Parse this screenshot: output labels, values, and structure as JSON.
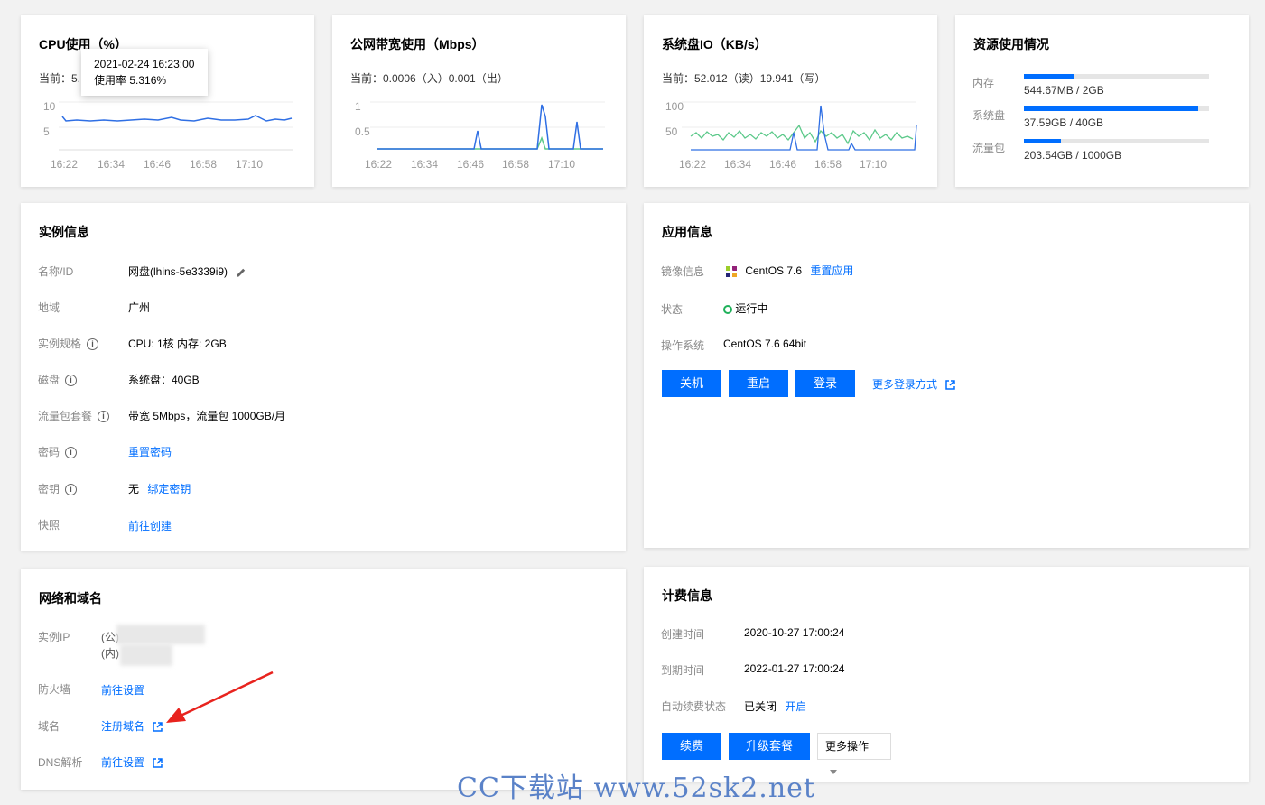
{
  "cpu": {
    "title": "CPU使用（%）",
    "current_label": "当前：5.",
    "yticks": [
      "10",
      "5"
    ],
    "xticks": [
      "16:22",
      "16:34",
      "16:46",
      "16:58",
      "17:10"
    ],
    "tooltip_time": "2021-02-24 16:23:00",
    "tooltip_value": "使用率 5.316%"
  },
  "bandwidth": {
    "title": "公网带宽使用（Mbps）",
    "current": "当前：0.0006（入）0.001（出）",
    "yticks": [
      "1",
      "0.5"
    ],
    "xticks": [
      "16:22",
      "16:34",
      "16:46",
      "16:58",
      "17:10"
    ]
  },
  "disk_io": {
    "title": "系统盘IO（KB/s）",
    "current": "当前：52.012（读）19.941（写）",
    "yticks": [
      "100",
      "50"
    ],
    "xticks": [
      "16:22",
      "16:34",
      "16:46",
      "16:58",
      "17:10"
    ]
  },
  "resources": {
    "title": "资源使用情况",
    "items": [
      {
        "label": "内存",
        "value": "544.67MB / 2GB",
        "fraction": 0.27
      },
      {
        "label": "系统盘",
        "value": "37.59GB / 40GB",
        "fraction": 0.94
      },
      {
        "label": "流量包",
        "value": "203.54GB / 1000GB",
        "fraction": 0.2
      }
    ]
  },
  "instance": {
    "title": "实例信息",
    "rows": {
      "name_label": "名称/ID",
      "name_value": "网盘(lhins-5e3339i9)",
      "region_label": "地域",
      "region_value": "广州",
      "spec_label": "实例规格",
      "spec_value": "CPU: 1核 内存: 2GB",
      "disk_label": "磁盘",
      "disk_value": "系统盘：40GB",
      "traffic_label": "流量包套餐",
      "traffic_value": "带宽 5Mbps，流量包 1000GB/月",
      "password_label": "密码",
      "password_link": "重置密码",
      "key_label": "密钥",
      "key_value": "无",
      "key_link": "绑定密钥",
      "snapshot_label": "快照",
      "snapshot_link": "前往创建"
    }
  },
  "app": {
    "title": "应用信息",
    "image_label": "镜像信息",
    "image_value": "CentOS 7.6",
    "image_link": "重置应用",
    "status_label": "状态",
    "status_value": "运行中",
    "os_label": "操作系统",
    "os_value": "CentOS 7.6 64bit",
    "btn_shutdown": "关机",
    "btn_restart": "重启",
    "btn_login": "登录",
    "more_login": "更多登录方式"
  },
  "network": {
    "title": "网络和域名",
    "ip_label": "实例IP",
    "ip_public": "(公)",
    "ip_private": "(内)",
    "firewall_label": "防火墙",
    "firewall_link": "前往设置",
    "domain_label": "域名",
    "domain_link": "注册域名",
    "dns_label": "DNS解析",
    "dns_link": "前往设置"
  },
  "billing": {
    "title": "计费信息",
    "created_label": "创建时间",
    "created_value": "2020-10-27 17:00:24",
    "expire_label": "到期时间",
    "expire_value": "2022-01-27 17:00:24",
    "renew_label": "自动续费状态",
    "renew_value": "已关闭",
    "renew_link": "开启",
    "btn_renew": "续费",
    "btn_upgrade": "升级套餐",
    "btn_more": "更多操作"
  },
  "watermark": "CC下载站  www.52sk2.net",
  "colors": {
    "accent": "#006eff",
    "line_blue": "#2f6fe4",
    "line_green": "#5cc98a",
    "status_green": "#20b15a",
    "arrow": "#e8231e"
  }
}
